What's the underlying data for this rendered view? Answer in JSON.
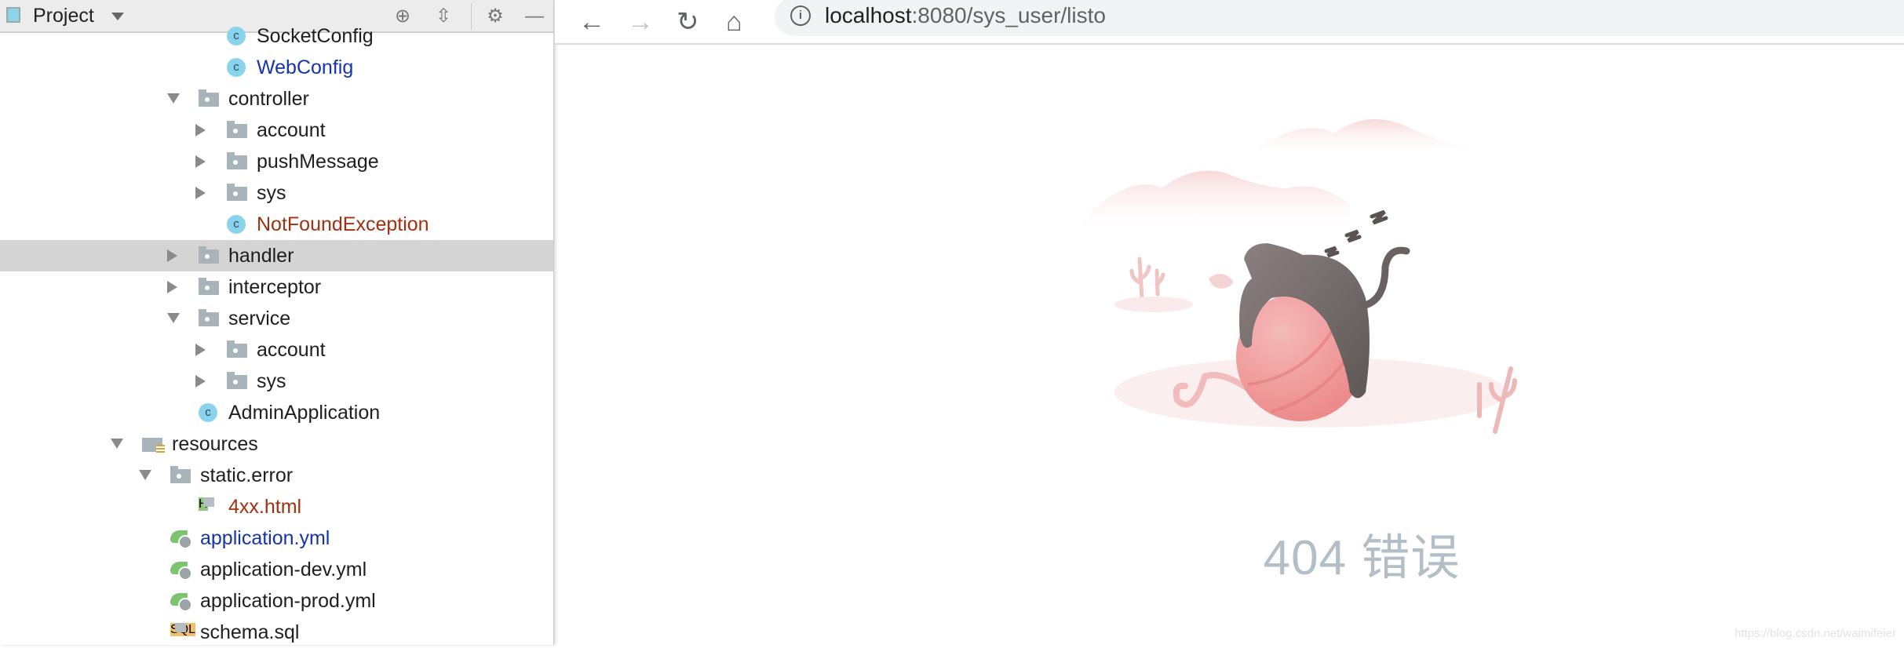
{
  "ide": {
    "panel_title": "Project",
    "header_icons": [
      "locate-icon",
      "collapse-all-icon",
      "gear-icon",
      "minimize-icon"
    ],
    "tree": [
      {
        "label": "SocketConfig",
        "icon": "class-icon",
        "level": 3,
        "color": "default"
      },
      {
        "label": "WebConfig",
        "icon": "class-icon",
        "level": 3,
        "color": "blue"
      },
      {
        "label": "controller",
        "icon": "folder-icon",
        "level": 2,
        "expand": "open"
      },
      {
        "label": "account",
        "icon": "folder-icon",
        "level": 3,
        "expand": "closed"
      },
      {
        "label": "pushMessage",
        "icon": "folder-icon",
        "level": 3,
        "expand": "closed"
      },
      {
        "label": "sys",
        "icon": "folder-icon",
        "level": 3,
        "expand": "closed"
      },
      {
        "label": "NotFoundException",
        "icon": "class-icon",
        "level": 3,
        "color": "red"
      },
      {
        "label": "handler",
        "icon": "folder-icon",
        "level": 2,
        "expand": "closed",
        "selected": true
      },
      {
        "label": "interceptor",
        "icon": "folder-icon",
        "level": 2,
        "expand": "closed"
      },
      {
        "label": "service",
        "icon": "folder-icon",
        "level": 2,
        "expand": "open"
      },
      {
        "label": "account",
        "icon": "folder-icon",
        "level": 3,
        "expand": "closed"
      },
      {
        "label": "sys",
        "icon": "folder-icon",
        "level": 3,
        "expand": "closed"
      },
      {
        "label": "AdminApplication",
        "icon": "spring-boot-class-icon",
        "level": 2
      },
      {
        "label": "resources",
        "icon": "resources-folder-icon",
        "level": 0,
        "expand": "open"
      },
      {
        "label": "static.error",
        "icon": "folder-icon",
        "level": 1,
        "expand": "open"
      },
      {
        "label": "4xx.html",
        "icon": "html-file-icon",
        "badge": "H",
        "level": 2,
        "color": "red"
      },
      {
        "label": "application.yml",
        "icon": "spring-yml-icon",
        "level": 1,
        "color": "blue"
      },
      {
        "label": "application-dev.yml",
        "icon": "spring-yml-icon",
        "level": 1
      },
      {
        "label": "application-prod.yml",
        "icon": "spring-yml-icon",
        "level": 1
      },
      {
        "label": "schema.sql",
        "icon": "sql-file-icon",
        "badge": "SQL",
        "level": 1
      }
    ]
  },
  "browser": {
    "url_host": "localhost",
    "url_rest": ":8080/sys_user/listo",
    "error_text": "404 错误",
    "watermark": "https://blog.csdn.net/waimifeier"
  },
  "colors": {
    "selection": "#d4d4d4",
    "blue_file": "#1534a8",
    "red_file": "#a0300f",
    "yarn": "#ee8f8f",
    "cat": "#6f6867"
  }
}
